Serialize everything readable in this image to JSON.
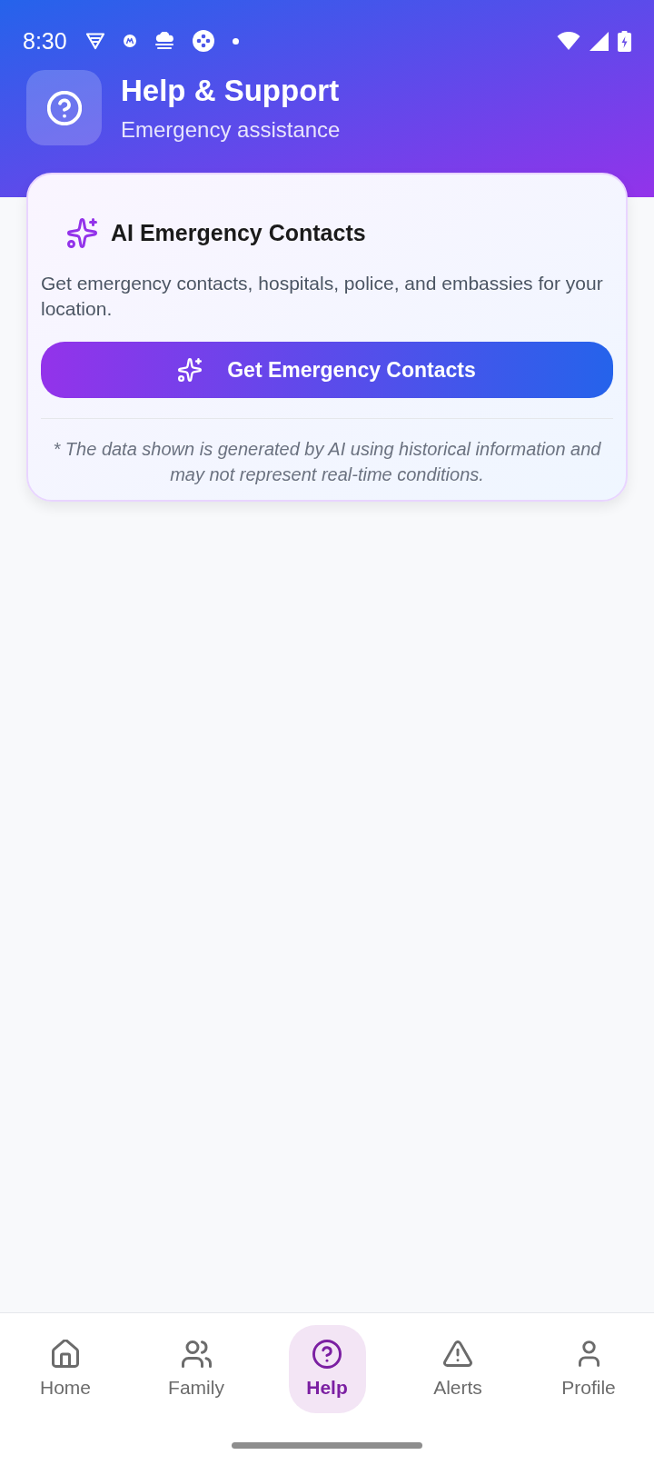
{
  "status_bar": {
    "time": "8:30"
  },
  "header": {
    "title": "Help & Support",
    "subtitle": "Emergency assistance"
  },
  "card": {
    "title": "AI Emergency Contacts",
    "description": "Get emergency contacts, hospitals, police, and embassies for your location.",
    "button": {
      "label": "Get Emergency Contacts"
    },
    "disclaimer": "* The data shown is generated by AI using historical information and may not represent real-time conditions."
  },
  "nav": [
    {
      "label": "Home",
      "selected": false
    },
    {
      "label": "Family",
      "selected": false
    },
    {
      "label": "Help",
      "selected": true
    },
    {
      "label": "Alerts",
      "selected": false
    },
    {
      "label": "Profile",
      "selected": false
    }
  ]
}
